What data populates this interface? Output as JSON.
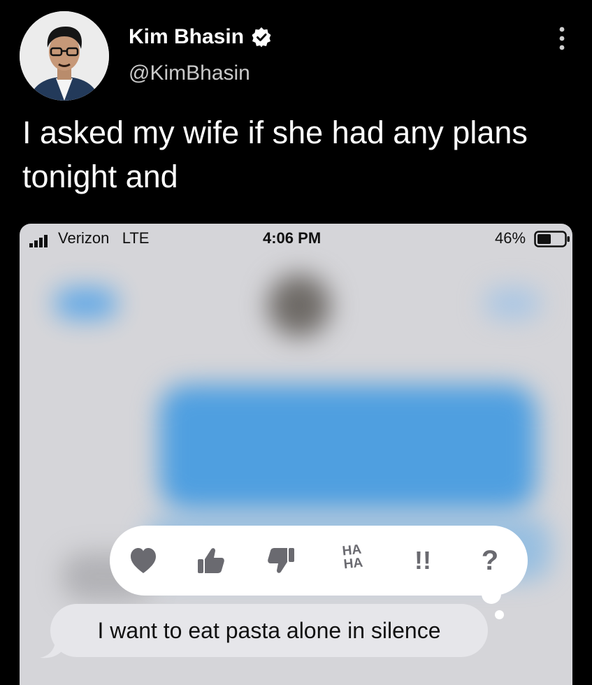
{
  "tweet": {
    "author": {
      "name": "Kim Bhasin",
      "handle": "@KimBhasin",
      "verified": true
    },
    "text": "I asked my wife if she had any plans tonight and"
  },
  "phone": {
    "status_bar": {
      "carrier": "Verizon",
      "network": "LTE",
      "time": "4:06 PM",
      "battery": "46%"
    },
    "reactions": [
      {
        "name": "heart-icon"
      },
      {
        "name": "thumbs-up-icon"
      },
      {
        "name": "thumbs-down-icon"
      },
      {
        "name": "haha-icon",
        "label_top": "HA",
        "label_bottom": "HA"
      },
      {
        "name": "exclamation-icon",
        "label": "!!"
      },
      {
        "name": "question-icon",
        "label": "?"
      }
    ],
    "message": "I want to eat pasta alone in silence"
  },
  "colors": {
    "background": "#000000",
    "phone_background": "#d5d5d9",
    "blurred_blue": "#4ca0e8",
    "reaction_icon": "#6a6a70",
    "received_bubble": "#e6e6ea"
  }
}
